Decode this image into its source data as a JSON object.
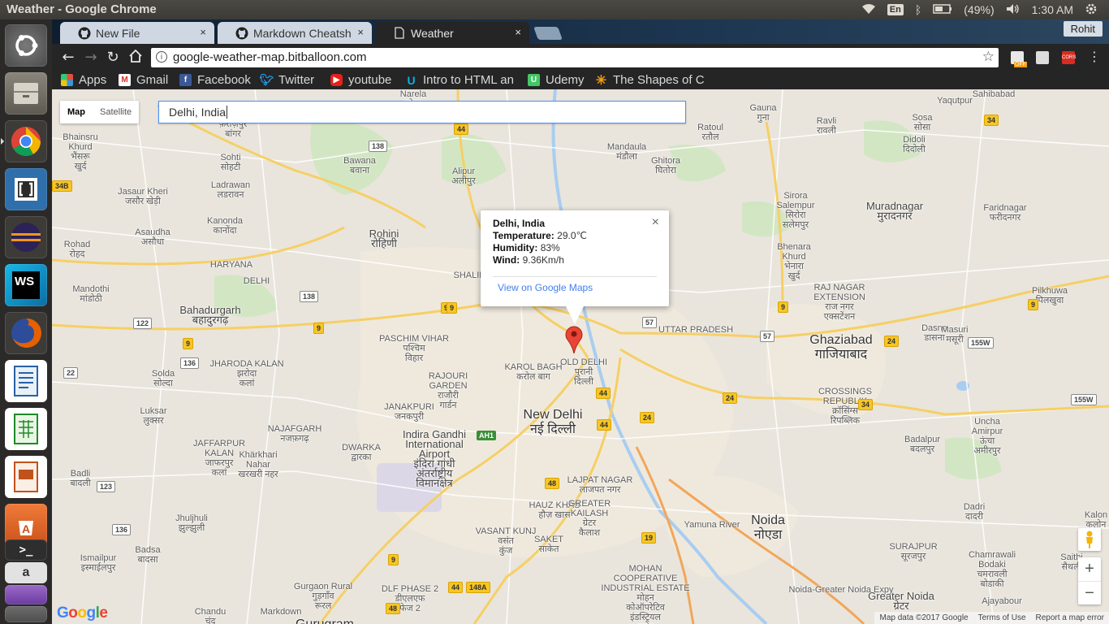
{
  "system": {
    "window_title": "Weather - Google Chrome",
    "keyboard_lang": "En",
    "battery": "(49%)",
    "clock": "1:30 AM"
  },
  "launcher": {
    "apps": [
      "ubuntu-dash",
      "files",
      "chrome",
      "brackets",
      "eclipse",
      "webstorm",
      "firefox",
      "libreoffice-writer",
      "libreoffice-calc",
      "libreoffice-impress",
      "software-center",
      "terminal",
      "amazon"
    ]
  },
  "tabs": [
    {
      "label": "New File",
      "icon": "github-icon",
      "close": "×"
    },
    {
      "label": "Markdown Cheatsh",
      "icon": "github-icon",
      "close": "×"
    },
    {
      "label": "Weather",
      "icon": "page-icon",
      "close": "×"
    }
  ],
  "user": "Rohit",
  "address": {
    "url": "google-weather-map.bitballoon.com"
  },
  "bookmarks": [
    {
      "label": "Apps",
      "color": "#e74c3c"
    },
    {
      "label": "Gmail",
      "color": "#d93025"
    },
    {
      "label": "Facebook",
      "color": "#3b5998"
    },
    {
      "label": "Twitter",
      "color": "#1da1f2"
    },
    {
      "label": "youtube",
      "color": "#e62117"
    },
    {
      "label": "Intro to HTML an",
      "color": "#02b3e4"
    },
    {
      "label": "Udemy",
      "color": "#44c767"
    },
    {
      "label": "The Shapes of C",
      "color": "#f39c12"
    }
  ],
  "map": {
    "type_buttons": [
      "Map",
      "Satellite"
    ],
    "selected_type": "Map",
    "search_value": "Delhi, India",
    "labels": [
      [
        "Rohini\nरोहिणी",
        "mid"
      ],
      [
        "New Delhi\nनई दिल्ली",
        "big"
      ],
      [
        "Ghaziabad\nगाजियाबाद",
        "big"
      ],
      [
        "Noida\nनोएडा",
        "big"
      ],
      [
        "Gurugram",
        "big"
      ],
      [
        "Greater Noida\nग्रेटर",
        "mid"
      ],
      [
        "Bahadurgarh\nबहादुरगढ़",
        "mid"
      ],
      [
        "Muradnagar\nमुरादनगर",
        "mid"
      ],
      [
        "Indira Gandhi\nInternational\nAirport\nइंदिरा गांधी\nअंतर्राष्ट्रीय\nविमानक्षेत्र",
        "mid"
      ],
      [
        "PASCHIM VIHAR\nपश्चिम\nविहार",
        "sm"
      ],
      [
        "JANAKPURI\nजनकपुरी",
        "sm"
      ],
      [
        "KAROL BAGH\nकरोल बाग",
        "sm"
      ],
      [
        "OLD DELHI\nपुरानी\nदिल्ली",
        "sm"
      ],
      [
        "LAJPAT NAGAR\nलाजपत नगर",
        "sm"
      ],
      [
        "HAUZ KHAS\nहौज़ खास",
        "sm"
      ],
      [
        "GREATER\nKAILASH\nग्रेटर\nकैलाश",
        "sm"
      ],
      [
        "SHALIM",
        "sm"
      ],
      [
        "VASANT KUNJ\nवसंत\nकुंज",
        "sm"
      ],
      [
        "SAKET\nसाकेत",
        "sm"
      ],
      [
        "DWARKA\nद्वारका",
        "sm"
      ],
      [
        "NAJAFGARH\nनजफ़गढ़",
        "sm"
      ],
      [
        "RAJOURI\nGARDEN\nराजौरी\nगार्डन",
        "sm"
      ],
      [
        "Narela\nनरेला",
        "sm"
      ],
      [
        "Bawana\nबवाना",
        "sm"
      ],
      [
        "Alipur\nअलीपुर",
        "sm"
      ],
      [
        "Mandaula\nमंडौला",
        "sm"
      ],
      [
        "Ghitora\nघितोरा",
        "sm"
      ],
      [
        "Ratoul\nरतौल",
        "sm"
      ],
      [
        "Gauna\nगुना",
        "sm"
      ],
      [
        "Ravli\nरावली",
        "sm"
      ],
      [
        "Sohti\nसोहटी",
        "sm"
      ],
      [
        "Ladrawan\nलडरावन",
        "sm"
      ],
      [
        "Jasaur Kheri\nजसौर खेड़ी",
        "sm"
      ],
      [
        "Kanonda\nकानोंदा",
        "sm"
      ],
      [
        "Asaudha\nअसौधा",
        "sm"
      ],
      [
        "Rohad\nरोहद",
        "sm"
      ],
      [
        "Mandothi\nमांडोठी",
        "sm"
      ],
      [
        "Solda\nसोल्दा",
        "sm"
      ],
      [
        "Luksar\nलुक्सर",
        "sm"
      ],
      [
        "Badli\nबादली",
        "sm"
      ],
      [
        "Khärkhari\nNahar\nखरखरी नहर",
        "sm"
      ],
      [
        "Jhuljhuli\nझुल्झुली",
        "sm"
      ],
      [
        "Badsa\nबादसा",
        "sm"
      ],
      [
        "Ismailpur\nइस्माईलपुर",
        "sm"
      ],
      [
        "Chandu\nचंदू",
        "sm"
      ],
      [
        "Gurgaon Rural\nगुड़गाँव\nरूरल",
        "sm"
      ],
      [
        "Sirora\nSalempur\nसिरोरा\nसलेमपुर",
        "sm"
      ],
      [
        "Bhenara\nKhurd\nभेनारा\nखुर्द",
        "sm"
      ],
      [
        "RAJ NAGAR\nEXTENSION\nराज नगर\nएक्सटेंशन",
        "sm"
      ],
      [
        "Dasna\nडासना",
        "sm"
      ],
      [
        "Masuri\nमसूरी",
        "sm"
      ],
      [
        "Pilkhuwa\nपिलखुवा",
        "sm"
      ],
      [
        "Faridnagar\nफरीदनगर",
        "sm"
      ],
      [
        "Didoli\nदिदोली",
        "sm"
      ],
      [
        "Sosa\nसोसा",
        "sm"
      ],
      [
        "Yaqutpur",
        "sm"
      ],
      [
        "CROSSINGS\nREPUBLIK\nक्रॉसिंग्स\nरिपब्लिक",
        "sm"
      ],
      [
        "Uncha\nAmirpur\nऊंचा\nअमीरपुर",
        "sm"
      ],
      [
        "Badalpur\nबदलपुर",
        "sm"
      ],
      [
        "Dadri\nदादरी",
        "sm"
      ],
      [
        "SURAJPUR\nसूरजपुर",
        "sm"
      ],
      [
        "Chamrawali\nBodaki\nचमरावली\nबोडाकी",
        "sm"
      ],
      [
        "MOHAN\nCOOPERATIVE\nINDUSTRIAL ESTATE\nमोहन\nकोऑपरेटिव\nइंडस्ट्रियल\nएस्टेट",
        "sm"
      ],
      [
        "JHARODA KALAN\nझरोदा\nकलां",
        "sm"
      ],
      [
        "JAFFARPUR\nKALAN\nजाफरपुर\nकलां",
        "sm"
      ],
      [
        "DLF PHASE 2\nडीएलएफ\nफेज 2",
        "sm"
      ],
      [
        "Markdown",
        "sm"
      ],
      [
        "Bhainsru\nKhurd\nभैंसरू\nखुर्द",
        "sm"
      ],
      [
        "Bangar\nफ़ेरोज़पुर\nबांगर",
        "sm"
      ],
      [
        "Sahibabad",
        "sm"
      ],
      [
        "Ajayabour",
        "sm"
      ],
      [
        "Kalon\nकलोन",
        "sm"
      ],
      [
        "Saithi\nसैथली",
        "sm"
      ],
      [
        "HARYANA",
        "sm"
      ],
      [
        "DELHI",
        "sm"
      ],
      [
        "UTTAR PRADESH",
        "sm"
      ],
      [
        "Yamuna River",
        "sm"
      ],
      [
        "Noida-Greater Noida Expy",
        "sm"
      ]
    ],
    "shields": [
      [
        "44",
        "y"
      ],
      [
        "44",
        "y"
      ],
      [
        "44",
        "y"
      ],
      [
        "44",
        "y"
      ],
      [
        "34",
        "y"
      ],
      [
        "34",
        "y"
      ],
      [
        "9",
        "y"
      ],
      [
        "9",
        "y"
      ],
      [
        "9",
        "y"
      ],
      [
        "9",
        "y"
      ],
      [
        "9",
        "y"
      ],
      [
        "9",
        "y"
      ],
      [
        "9",
        "y"
      ],
      [
        "24",
        "y"
      ],
      [
        "24",
        "y"
      ],
      [
        "24",
        "y"
      ],
      [
        "48",
        "y"
      ],
      [
        "48",
        "y"
      ],
      [
        "19",
        "y"
      ],
      [
        "148A",
        "y"
      ],
      [
        "138",
        "w"
      ],
      [
        "138",
        "w"
      ],
      [
        "122",
        "w"
      ],
      [
        "136",
        "w"
      ],
      [
        "136",
        "w"
      ],
      [
        "123",
        "w"
      ],
      [
        "22",
        "w"
      ],
      [
        "57",
        "w"
      ],
      [
        "57",
        "w"
      ],
      [
        "155W",
        "w"
      ],
      [
        "155W",
        "w"
      ],
      [
        "34B",
        "y"
      ],
      [
        "AH1",
        "g"
      ]
    ],
    "infowindow": {
      "place": "Delhi, India",
      "temp_label": "Temperature:",
      "temp_value": "29.0℃",
      "hum_label": "Humidity:",
      "hum_value": "83%",
      "wind_label": "Wind:",
      "wind_value": "9.36Km/h",
      "link": "View on Google Maps",
      "close": "×"
    },
    "zoom_in": "+",
    "zoom_out": "−",
    "logo": "Google",
    "footer": [
      "Map data ©2017 Google",
      "Terms of Use",
      "Report a map error"
    ]
  }
}
